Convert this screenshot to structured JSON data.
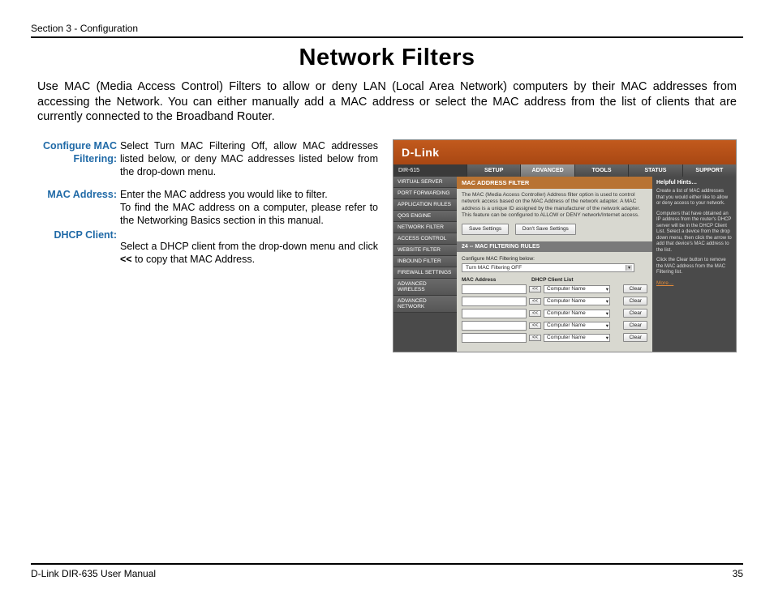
{
  "section_header": "Section 3 - Configuration",
  "page_title": "Network Filters",
  "intro": "Use MAC (Media Access Control) Filters to allow or deny LAN (Local Area Network) computers by their MAC addresses from accessing the Network. You can either manually add a MAC address or select the MAC address from the list of clients that are currently connected to the Broadband Router.",
  "defs": {
    "configure_label": "Configure MAC Filtering:",
    "configure_text": "Select Turn MAC Filtering Off, allow MAC addresses listed below, or deny MAC addresses listed below from the drop-down menu.",
    "mac_label": "MAC Address:",
    "mac_text1": "Enter the MAC address you would like to filter.",
    "mac_text2": "To find the MAC address on a computer, please refer to the Networking Basics section in this manual.",
    "dhcp_label": "DHCP Client:",
    "dhcp_text_pre": "Select a DHCP client from the drop-down menu and click ",
    "dhcp_text_bold": "<<",
    "dhcp_text_post": " to copy that MAC Address."
  },
  "ui": {
    "brand": "D-Link",
    "model": "DIR-615",
    "tabs": [
      "SETUP",
      "ADVANCED",
      "TOOLS",
      "STATUS",
      "SUPPORT"
    ],
    "active_tab": "ADVANCED",
    "sidenav": [
      "VIRTUAL SERVER",
      "PORT FORWARDING",
      "APPLICATION RULES",
      "QOS ENGINE",
      "NETWORK FILTER",
      "ACCESS CONTROL",
      "WEBSITE FILTER",
      "INBOUND FILTER",
      "FIREWALL SETTINGS",
      "ADVANCED WIRELESS",
      "ADVANCED NETWORK"
    ],
    "panel_title": "MAC ADDRESS FILTER",
    "panel_desc": "The MAC (Media Access Controller) Address filter option is used to control network access based on the MAC Address of the network adapter. A MAC address is a unique ID assigned by the manufacturer of the network adapter. This feature can be configured to ALLOW or DENY network/Internet access.",
    "save": "Save Settings",
    "dont_save": "Don't Save Settings",
    "rules_title": "24 -- MAC FILTERING RULES",
    "cfg_label": "Configure MAC Filtering below:",
    "cfg_value": "Turn MAC Filtering OFF",
    "col_mac": "MAC Address",
    "col_dhcp": "DHCP Client List",
    "copy": "<<",
    "client_placeholder": "Computer Name",
    "clear": "Clear",
    "row_count": 5,
    "hints_title": "Helpful Hints…",
    "hints_p1": "Create a list of MAC addresses that you would either like to allow or deny access to your network.",
    "hints_p2": "Computers that have obtained an IP address from the router's DHCP server will be in the DHCP Client List. Select a device from the drop down menu, then click the arrow to add that device's MAC address to the list.",
    "hints_p3": "Click the Clear button to remove the MAC address from the MAC Filtering list.",
    "more": "More…"
  },
  "footer_left": "D-Link DIR-635 User Manual",
  "footer_right": "35"
}
